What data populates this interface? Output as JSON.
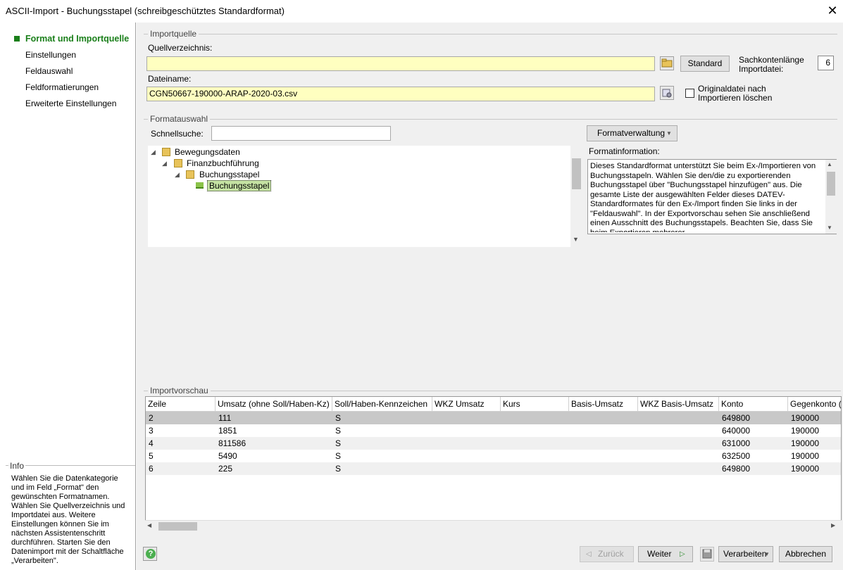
{
  "window": {
    "title": "ASCII-Import - Buchungsstapel (schreibgeschütztes Standardformat)",
    "close": "✕"
  },
  "nav": {
    "items": [
      {
        "label": "Format und Importquelle",
        "active": true
      },
      {
        "label": "Einstellungen"
      },
      {
        "label": "Feldauswahl"
      },
      {
        "label": "Feldformatierungen"
      },
      {
        "label": "Erweiterte Einstellungen"
      }
    ]
  },
  "info": {
    "title": "Info",
    "text": "Wählen Sie die Datenkategorie und im Feld „Format\" den gewünschten Formatnamen. Wählen Sie Quellverzeichnis und Importdatei aus. Weitere Einstellungen können Sie im nächsten Assistentenschritt durchführen. Starten Sie den Datenimport mit der Schaltfläche „Verarbeiten\"."
  },
  "importquelle": {
    "group": "Importquelle",
    "quell_label": "Quellverzeichnis:",
    "quell_value": "",
    "standard_btn": "Standard",
    "sachkonten_label": "Sachkontenlänge Importdatei:",
    "sachkonten_value": "6",
    "datei_label": "Dateiname:",
    "datei_value": "CGN50667-190000-ARAP-2020-03.csv",
    "original_label": "Originaldatei nach Importieren löschen"
  },
  "formatauswahl": {
    "group": "Formatauswahl",
    "schnell_label": "Schnellsuche:",
    "schnell_value": "",
    "formatverwaltung_btn": "Formatverwaltung",
    "tree": [
      {
        "label": "Bewegungsdaten",
        "level": 0
      },
      {
        "label": "Finanzbuchführung",
        "level": 1
      },
      {
        "label": "Buchungsstapel",
        "level": 2
      },
      {
        "label": "Buchungsstapel",
        "level": 3,
        "selected": true
      }
    ],
    "info_label": "Formatinformation:",
    "info_text": "Dieses Standardformat unterstützt Sie beim Ex-/Importieren von Buchungsstapeln. Wählen Sie den/die zu exportierenden Buchungsstapel über \"Buchungsstapel hinzufügen\" aus. Die gesamte Liste der ausgewählten Felder dieses DATEV-Standardformates für den Ex-/Import finden Sie links in der \"Feldauswahl\". In der Exportvorschau sehen Sie anschließend einen Ausschnitt des Buchungsstapels. Beachten Sie, dass Sie beim Exportieren mehrerer"
  },
  "vorschau": {
    "group": "Importvorschau",
    "columns": [
      "Zeile",
      "Umsatz (ohne Soll/Haben-Kz)",
      "Soll/Haben-Kennzeichen",
      "WKZ Umsatz",
      "Kurs",
      "Basis-Umsatz",
      "WKZ Basis-Umsatz",
      "Konto",
      "Gegenkonto (o"
    ],
    "rows": [
      [
        "2",
        "111",
        "S",
        "",
        "",
        "",
        "",
        "649800",
        "190000"
      ],
      [
        "3",
        "1851",
        "S",
        "",
        "",
        "",
        "",
        "640000",
        "190000"
      ],
      [
        "4",
        "811586",
        "S",
        "",
        "",
        "",
        "",
        "631000",
        "190000"
      ],
      [
        "5",
        "5490",
        "S",
        "",
        "",
        "",
        "",
        "632500",
        "190000"
      ],
      [
        "6",
        "225",
        "S",
        "",
        "",
        "",
        "",
        "649800",
        "190000"
      ]
    ]
  },
  "footer": {
    "zurueck": "Zurück",
    "weiter": "Weiter",
    "verarbeiten": "Verarbeiten",
    "abbrechen": "Abbrechen",
    "help": "?"
  }
}
